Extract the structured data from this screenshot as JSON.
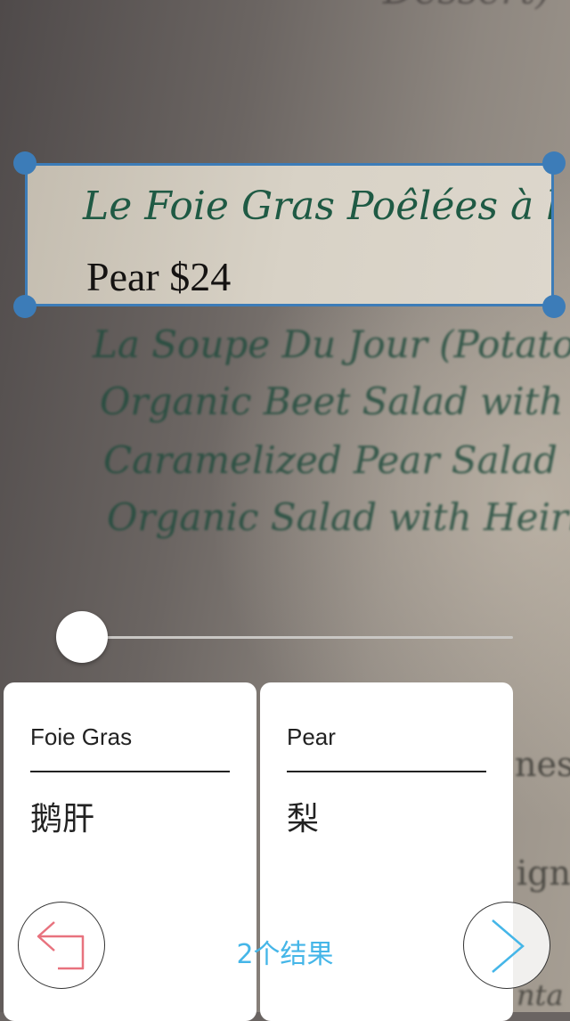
{
  "camera_view": {
    "menu_lines": [
      "Dessert)",
      "La Soupe Du Jour (Potato",
      "Organic Beet Salad with G",
      "Caramelized Pear Salad wi",
      "Organic Salad  with Heirlo",
      "nes",
      "ign",
      "nta"
    ]
  },
  "selection": {
    "line1": "Le Foie Gras Poêlées à la",
    "line2": "Pear $24"
  },
  "slider": {
    "value": 0.0
  },
  "results": [
    {
      "term": "Foie Gras",
      "translation": "鹅肝"
    },
    {
      "term": "Pear",
      "translation": "梨"
    }
  ],
  "footer": {
    "result_count": "2个结果"
  },
  "icons": {
    "back": "back-arrow-icon",
    "next": "chevron-right-icon"
  },
  "colors": {
    "accent": "#45b6e8",
    "selection": "#3c7cb8",
    "back_icon": "#e8727e"
  }
}
